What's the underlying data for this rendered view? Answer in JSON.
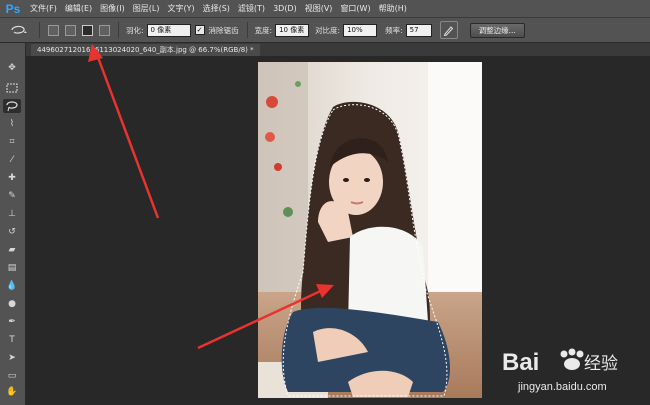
{
  "app": {
    "logo": "Ps"
  },
  "menu": {
    "items": [
      {
        "label": "文件(F)"
      },
      {
        "label": "编辑(E)"
      },
      {
        "label": "图像(I)"
      },
      {
        "label": "图层(L)"
      },
      {
        "label": "文字(Y)"
      },
      {
        "label": "选择(S)"
      },
      {
        "label": "滤镜(T)"
      },
      {
        "label": "3D(D)"
      },
      {
        "label": "视图(V)"
      },
      {
        "label": "窗口(W)"
      },
      {
        "label": "帮助(H)"
      }
    ]
  },
  "options": {
    "feather_label": "羽化:",
    "feather_value": "0 像素",
    "antialias_label": "消除锯齿",
    "antialias_checked": true,
    "width_label": "宽度:",
    "width_value": "10 像素",
    "contrast_label": "对比度:",
    "contrast_value": "10%",
    "frequency_label": "频率:",
    "frequency_value": "57",
    "refine_edge_label": "调整边缘..."
  },
  "document": {
    "tab_title": "4496027120161611302402​0_640_副本.jpg @ 66.7%(RGB/8) *"
  },
  "watermark": {
    "brand_text": "Bai",
    "brand_text2": "百",
    "suffix": "经验",
    "url": "jingyan.baidu.com"
  },
  "colors": {
    "menubar_bg": "#535353",
    "canvas_bg": "#282828",
    "arrow": "#e8332e",
    "ps_blue": "#31a8ff"
  }
}
